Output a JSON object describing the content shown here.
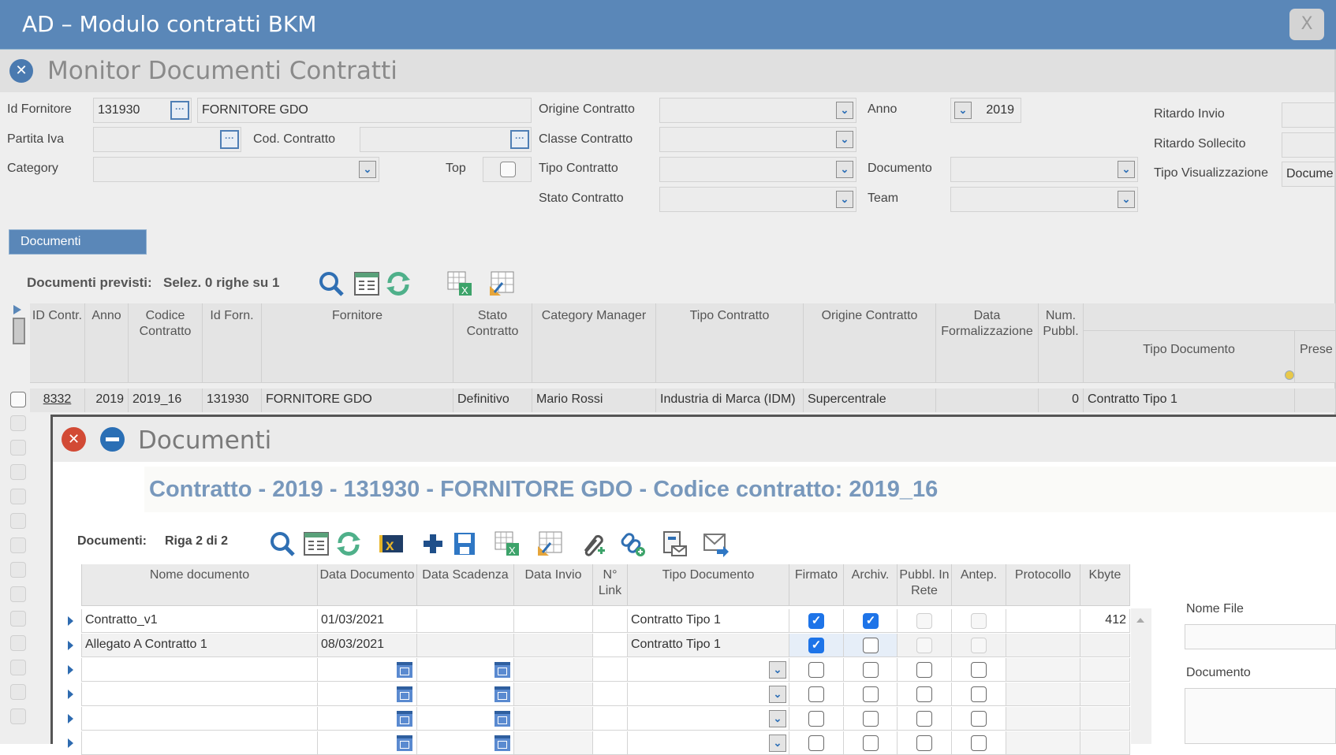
{
  "window": {
    "title": "AD – Modulo contratti BKM",
    "close_label": "X"
  },
  "header": {
    "title": "Monitor Documenti Contratti"
  },
  "filters": {
    "id_fornitore": {
      "label": "Id Fornitore",
      "value": "131930",
      "name_value": "FORNITORE GDO"
    },
    "partita_iva": {
      "label": "Partita Iva",
      "value": ""
    },
    "cod_contratto": {
      "label": "Cod. Contratto",
      "value": ""
    },
    "category": {
      "label": "Category",
      "value": ""
    },
    "top": {
      "label": "Top",
      "checked": false
    },
    "origine_contratto": {
      "label": "Origine Contratto",
      "value": ""
    },
    "classe_contratto": {
      "label": "Classe Contratto",
      "value": ""
    },
    "tipo_contratto": {
      "label": "Tipo Contratto",
      "value": ""
    },
    "stato_contratto": {
      "label": "Stato Contratto",
      "value": ""
    },
    "anno": {
      "label": "Anno",
      "value": "2019"
    },
    "documento": {
      "label": "Documento",
      "value": ""
    },
    "team": {
      "label": "Team",
      "value": ""
    },
    "ritardo_invio": {
      "label": "Ritardo Invio",
      "value": ""
    },
    "ritardo_sollecito": {
      "label": "Ritardo Sollecito",
      "value": ""
    },
    "tipo_visualizzazione": {
      "label": "Tipo Visualizzazione",
      "value": "Docume"
    }
  },
  "tabs": [
    {
      "label": "Documenti",
      "active": true
    }
  ],
  "main_grid": {
    "caption": "Documenti previsti:",
    "selection": "Selez. 0 righe su 1",
    "toolbar_icons": [
      "search-icon",
      "grid-view-icon",
      "refresh-icon",
      "export-excel-icon",
      "edit-grid-icon"
    ],
    "columns": [
      "ID Contr.",
      "Anno",
      "Codice Contratto",
      "Id Forn.",
      "Fornitore",
      "Stato Contratto",
      "Category Manager",
      "Tipo Contratto",
      "Origine Contratto",
      "Data Formalizzazione",
      "Num. Pubbl.",
      "Tipo Documento",
      "Prese"
    ],
    "rows": [
      {
        "id": "8332",
        "anno": "2019",
        "codice": "2019_16",
        "id_forn": "131930",
        "fornitore": "FORNITORE GDO",
        "stato": "Definitivo",
        "category_manager": "Mario Rossi",
        "tipo_contratto": "Industria di Marca (IDM)",
        "origine": "Supercentrale",
        "data_formalizzazione": "",
        "num_pubbl": "0",
        "tipo_documento": "Contratto Tipo 1"
      }
    ]
  },
  "popup": {
    "title": "Documenti",
    "heading": "Contratto - 2019 - 131930 - FORNITORE GDO - Codice contratto: 2019_16",
    "caption": "Documenti:",
    "position": "Riga 2 di 2",
    "toolbar_icons": [
      "search-icon",
      "grid-view-icon",
      "refresh-icon",
      "clear-filter-icon",
      "add-icon",
      "save-icon",
      "export-excel-icon",
      "edit-grid-icon",
      "attach-icon",
      "add-link-icon",
      "print-mail-icon",
      "send-mail-icon"
    ],
    "columns": [
      "Nome documento",
      "Data Documento",
      "Data Scadenza",
      "Data Invio",
      "N° Link",
      "Tipo Documento",
      "Firmato",
      "Archiv.",
      "Pubbl. In Rete",
      "Antep.",
      "Protocollo",
      "Kbyte"
    ],
    "rows": [
      {
        "nome": "Contratto_v1",
        "data_documento": "01/03/2021",
        "data_scadenza": "",
        "data_invio": "",
        "n_link": "",
        "tipo": "Contratto Tipo 1",
        "firmato": true,
        "archiv": true,
        "protocollo": "",
        "kbyte": "412"
      },
      {
        "nome": "Allegato A Contratto 1",
        "data_documento": "08/03/2021",
        "data_scadenza": "",
        "data_invio": "",
        "n_link": "",
        "tipo": "Contratto Tipo 1",
        "firmato": true,
        "archiv": false,
        "protocollo": "",
        "kbyte": ""
      }
    ],
    "side": {
      "nome_file_label": "Nome File",
      "nome_file_value": "",
      "documento_label": "Documento",
      "documento_value": ""
    }
  }
}
